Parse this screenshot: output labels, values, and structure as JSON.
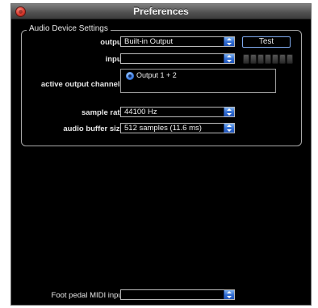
{
  "window": {
    "title": "Preferences"
  },
  "audio_settings": {
    "group_label": "Audio Device Settings",
    "output_label": "output:",
    "output_value": "Built-in Output",
    "test_button": "Test",
    "input_label": "input:",
    "input_value": "",
    "channels_label": "active output channels:",
    "channel_option": "Output 1 + 2",
    "sample_rate_label": "sample rate:",
    "sample_rate_value": "44100 Hz",
    "buffer_label": "audio buffer size:",
    "buffer_value": "512 samples (11.6 ms)"
  },
  "midi": {
    "foot_pedal_label": "Foot pedal MIDI input:",
    "foot_pedal_value": ""
  },
  "colors": {
    "accent": "#2f6bd3",
    "background": "#000000",
    "close": "#d9372b"
  },
  "icons": [
    "close-icon",
    "popup-stepper-icon",
    "radio-selected-icon",
    "input-level-meter"
  ]
}
